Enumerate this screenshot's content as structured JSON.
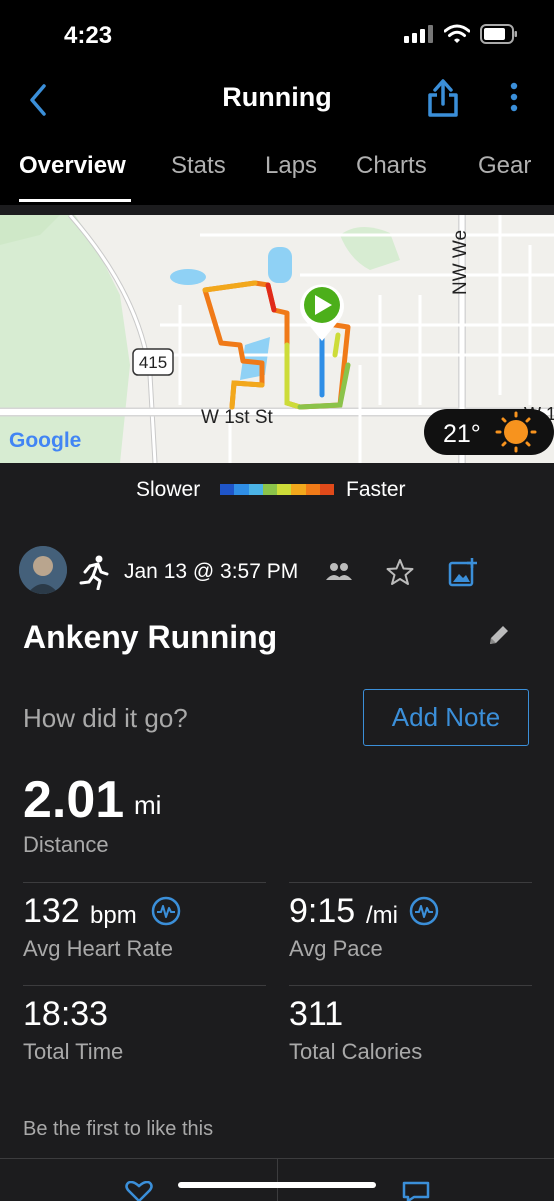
{
  "status_bar": {
    "time": "4:23"
  },
  "header": {
    "title": "Running"
  },
  "tabs": [
    {
      "label": "Overview",
      "active": true
    },
    {
      "label": "Stats"
    },
    {
      "label": "Laps"
    },
    {
      "label": "Charts"
    },
    {
      "label": "Gear"
    }
  ],
  "map": {
    "road_415": "415",
    "street_w1st": "W 1st St",
    "street_nw": "NW We",
    "street_w_right": "W 1",
    "google_logo": "Google",
    "temperature": "21°"
  },
  "pace_legend": {
    "slower": "Slower",
    "faster": "Faster",
    "colors": [
      "#1f55c9",
      "#2f8ee6",
      "#4bb3e6",
      "#8bc34a",
      "#cddc39",
      "#f2a81c",
      "#f07a18",
      "#e04a1a"
    ]
  },
  "activity": {
    "date": "Jan 13 @ 3:57 PM",
    "name": "Ankeny Running",
    "prompt": "How did it go?",
    "add_note": "Add Note",
    "distance": {
      "value": "2.01",
      "unit": "mi",
      "label": "Distance"
    },
    "heart_rate": {
      "value": "132",
      "unit": "bpm",
      "label": "Avg Heart Rate"
    },
    "pace": {
      "value": "9:15",
      "unit": "/mi",
      "label": "Avg Pace"
    },
    "time": {
      "value": "18:33",
      "label": "Total Time"
    },
    "calories": {
      "value": "311",
      "label": "Total Calories"
    },
    "likes_text": "Be the first to like this"
  },
  "accent_color": "#3b8fd9"
}
